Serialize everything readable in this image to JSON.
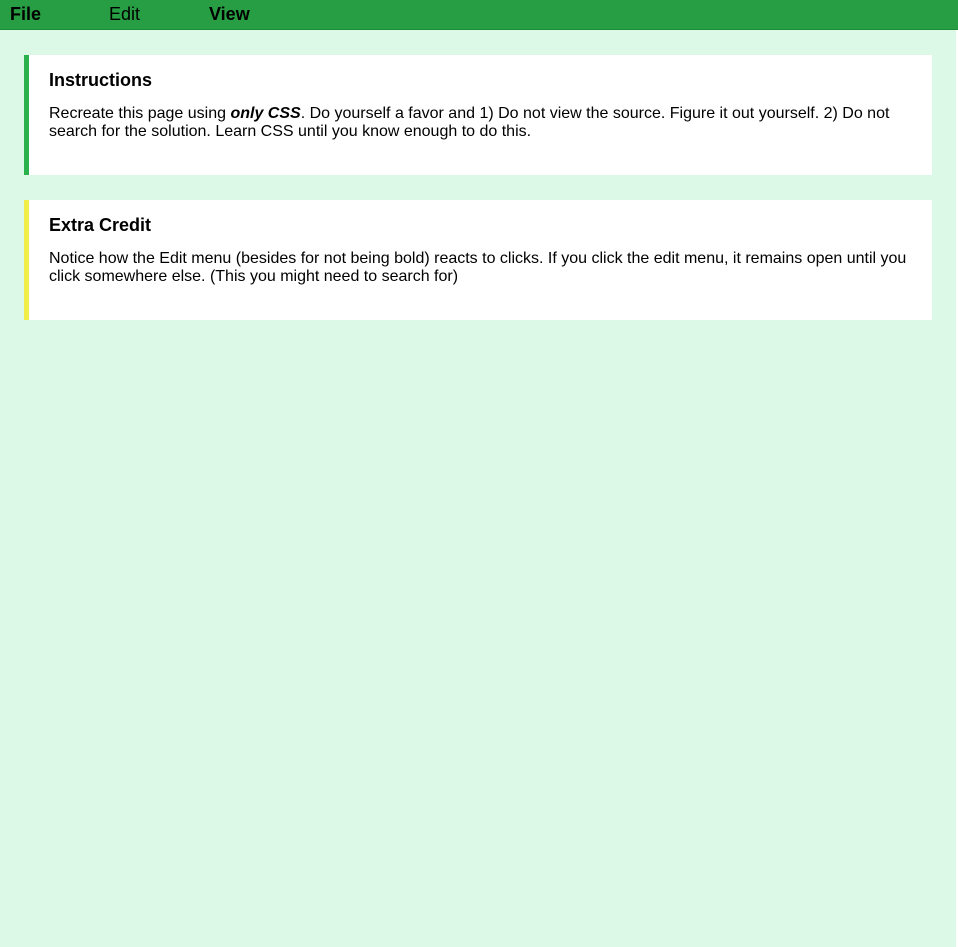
{
  "menubar": {
    "items": [
      {
        "label": "File"
      },
      {
        "label": "Edit"
      },
      {
        "label": "View"
      }
    ]
  },
  "instructions": {
    "title": "Instructions",
    "text_before": "Recreate this page using ",
    "emphasis": "only CSS",
    "text_after": ". Do yourself a favor and 1) Do not view the source. Figure it out yourself. 2) Do not search for the solution. Learn CSS until you know enough to do this."
  },
  "extra_credit": {
    "title": "Extra Credit",
    "text": "Notice how the Edit menu (besides for not being bold) reacts to clicks. If you click the edit menu, it remains open until you click somewhere else. (This you might need to search for)"
  },
  "colors": {
    "background": "#dcf8e7",
    "menubar": "#279e43",
    "instructions_accent": "#2bb24c",
    "extra_credit_accent": "#f2ee49"
  }
}
